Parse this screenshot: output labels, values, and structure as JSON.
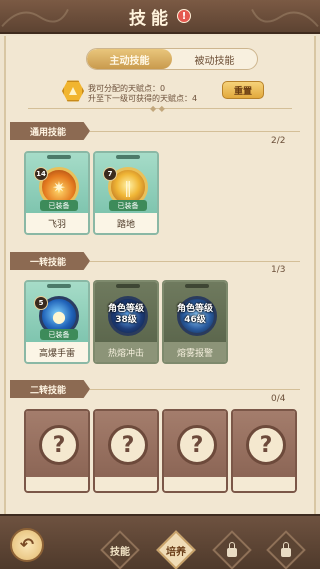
{
  "header": {
    "title": "技能",
    "info_mark": "!"
  },
  "tabs": [
    {
      "label": "主动技能",
      "active": true
    },
    {
      "label": "被动技能",
      "active": false
    }
  ],
  "talent": {
    "line1": "我可分配的天赋点：0",
    "line2": "升至下一级可获得的天赋点：4",
    "reset_label": "重置"
  },
  "sections": [
    {
      "title": "通用技能",
      "count": "2/2",
      "skills": [
        {
          "name": "飞羽",
          "level": "14",
          "status": "已装备",
          "icon": "fire-feather-icon"
        },
        {
          "name": "踏地",
          "level": "7",
          "status": "已装备",
          "icon": "ground-stomp-icon"
        }
      ]
    },
    {
      "title": "一转技能",
      "count": "1/3",
      "skills": [
        {
          "name": "高爆手雷",
          "level": "5",
          "status": "已装备",
          "icon": "grenade-icon"
        },
        {
          "name": "热熔冲击",
          "requirement": "角色等级\n38级",
          "icon": "heat-impact-icon"
        },
        {
          "name": "熔雾报警",
          "requirement": "角色等级\n46级",
          "icon": "fog-alarm-icon"
        }
      ]
    },
    {
      "title": "二转技能",
      "count": "0/4",
      "slots": [
        "?",
        "?",
        "?",
        "?"
      ]
    }
  ],
  "nav": [
    {
      "label": "技能",
      "active": false
    },
    {
      "label": "培养",
      "active": true
    },
    {
      "label": "",
      "locked": true
    },
    {
      "label": "",
      "locked": true
    }
  ],
  "colors": {
    "header_bg": "#6b4e3b",
    "parchment": "#f2e7d2",
    "card_green": "#8cccb6",
    "card_grey": "#6b7659",
    "card_locked": "#956f5f",
    "accent_gold": "#e9c15a"
  }
}
